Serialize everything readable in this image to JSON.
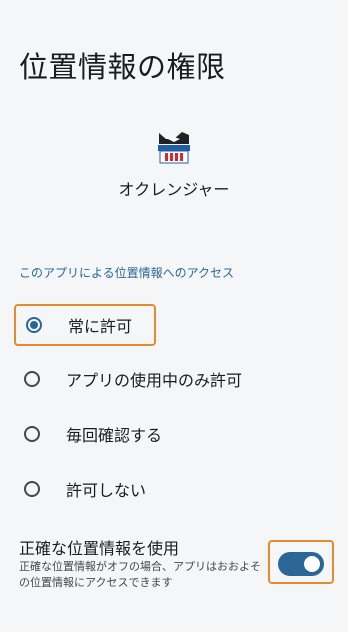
{
  "page": {
    "title": "位置情報の権限"
  },
  "app": {
    "name": "オクレンジャー",
    "icon": "app-logo-icon"
  },
  "section": {
    "header": "このアプリによる位置情報へのアクセス"
  },
  "options": [
    {
      "label": "常に許可",
      "selected": true
    },
    {
      "label": "アプリの使用中のみ許可",
      "selected": false
    },
    {
      "label": "毎回確認する",
      "selected": false
    },
    {
      "label": "許可しない",
      "selected": false
    }
  ],
  "precise": {
    "title": "正確な位置情報を使用",
    "description": "正確な位置情報がオフの場合、アプリはおおよその位置情報にアクセスできます",
    "enabled": true
  },
  "colors": {
    "accent": "#2a6796",
    "highlight": "#e8892f",
    "background": "#f5f6f7"
  }
}
